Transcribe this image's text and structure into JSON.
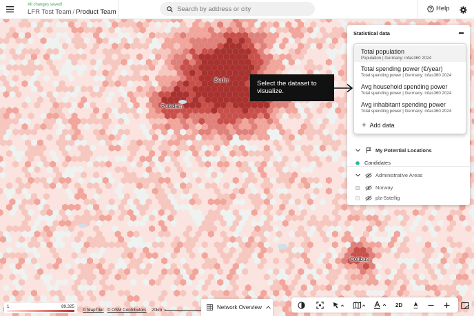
{
  "header": {
    "saved_status": "All changes saved!",
    "team": "LFR Test Team",
    "separator": "/",
    "project": "Product Team",
    "search_placeholder": "Search by address or city",
    "help_label": "Help"
  },
  "map": {
    "cities": [
      "Berlin",
      "Potsdam",
      "Cottbus"
    ],
    "colors": {
      "light": "#fbe3df",
      "mid": "#f1a59b",
      "dark": "#c9504a",
      "darkest": "#a8322f"
    }
  },
  "panel": {
    "title": "Statistical data",
    "dropdown_options": [
      {
        "title": "Total population",
        "subtitle": "Population | Germany: infas360 2024"
      },
      {
        "title": "Total spending power (€/year)",
        "subtitle": "Total spending power | Germany: infas360 2024"
      },
      {
        "title": "Avg household spending power",
        "subtitle": "Total spending power | Germany: infas360 2024"
      },
      {
        "title": "Avg inhabitant spending power",
        "subtitle": "Total spending power | Germany: infas360 2024"
      }
    ],
    "add_data_label": "Add data",
    "layers": {
      "potential_locations": "My Potential Locations",
      "candidates": "Candidates",
      "admin_areas": "Administrative Areas",
      "norway": "Norway",
      "plz": "plz-5stellig"
    }
  },
  "tooltip": {
    "text": "Select the dataset to visualize."
  },
  "legend": {
    "min": "1",
    "max": "89,325"
  },
  "attribution": {
    "maptiler": "© MapTiler",
    "osm": "© OSM Contributors"
  },
  "scale": {
    "label": "20km"
  },
  "bottom": {
    "network_label": "Network Overview",
    "mode_2d": "2D"
  }
}
